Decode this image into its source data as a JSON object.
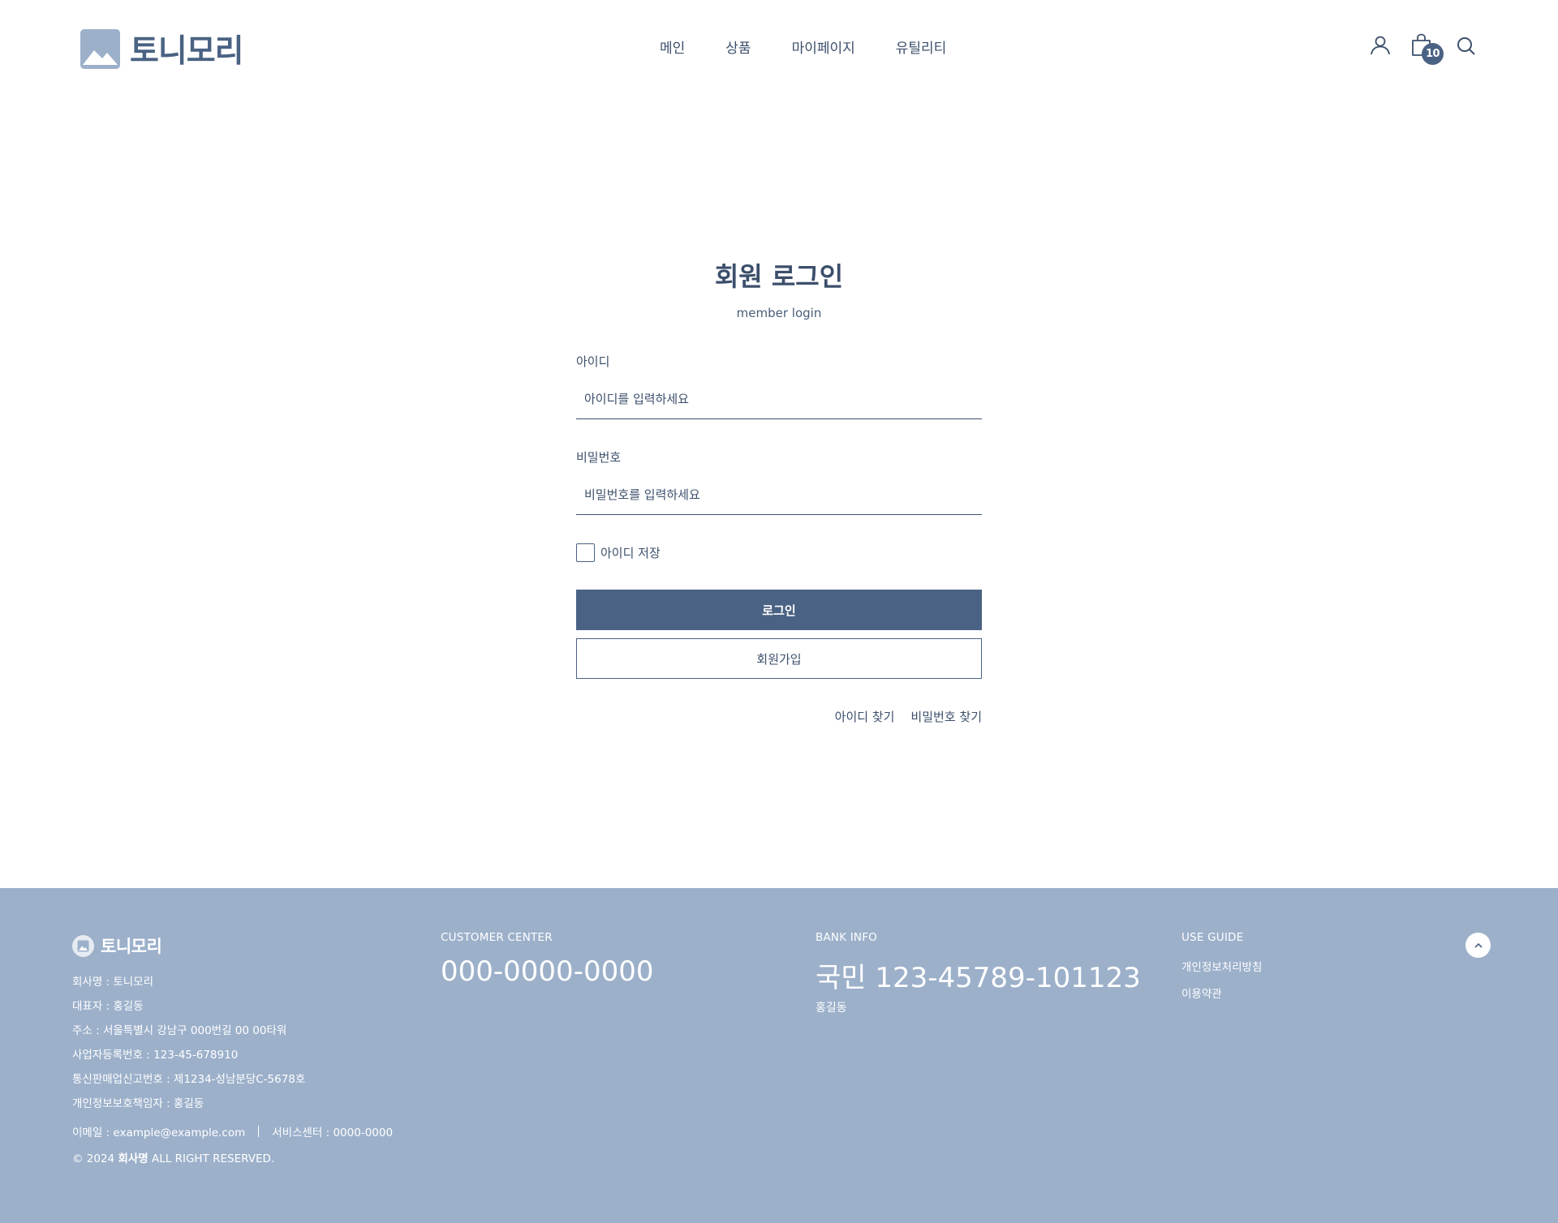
{
  "header": {
    "logo_text": "토니모리",
    "nav": [
      "메인",
      "상품",
      "마이페이지",
      "유틸리티"
    ],
    "cart_count": "10",
    "icons": [
      "user-icon",
      "cart-icon",
      "search-icon"
    ]
  },
  "login": {
    "title": "회원 로그인",
    "subtitle": "member login",
    "id_label": "아이디",
    "id_placeholder": "아이디를 입력하세요",
    "pw_label": "비밀번호",
    "pw_placeholder": "비밀번호를 입력하세요",
    "save_id_label": "아이디 저장",
    "login_button": "로그인",
    "join_button": "회원가입",
    "find_id": "아이디 찾기",
    "find_pw": "비밀번호 찾기"
  },
  "footer": {
    "logo_text": "토니모리",
    "company": "회사명 : 토니모리",
    "ceo": "대표자 : 홍길동",
    "address": "주소 : 서울특별시 강남구 000번길 00 00타워",
    "biz_number": "사업자등록번호 : 123-45-678910",
    "ecommerce_number": "통신판매업신고번호 : 제1234-성남분당C-5678호",
    "privacy_officer": "개인정보보호책임자 : 홍길동",
    "email": "이메일 : example@example.com",
    "service_center": "서비스센터 : 0000-0000",
    "copyright_prefix": "© 2024",
    "copyright_company": "회사명",
    "copyright_suffix": "ALL RIGHT RESERVED.",
    "customer_center_title": "CUSTOMER CENTER",
    "customer_center_phone": "000-0000-0000",
    "bank_info_title": "BANK INFO",
    "bank_account": "국민 123-45789-101123",
    "bank_holder": "홍길동",
    "use_guide_title": "USE GUIDE",
    "use_guide_links": [
      "개인정보처리방침",
      "이용약관"
    ]
  },
  "colors": {
    "accent": "#4a6283",
    "text": "#3c4f6b",
    "footer_bg": "#9cb0ca"
  }
}
